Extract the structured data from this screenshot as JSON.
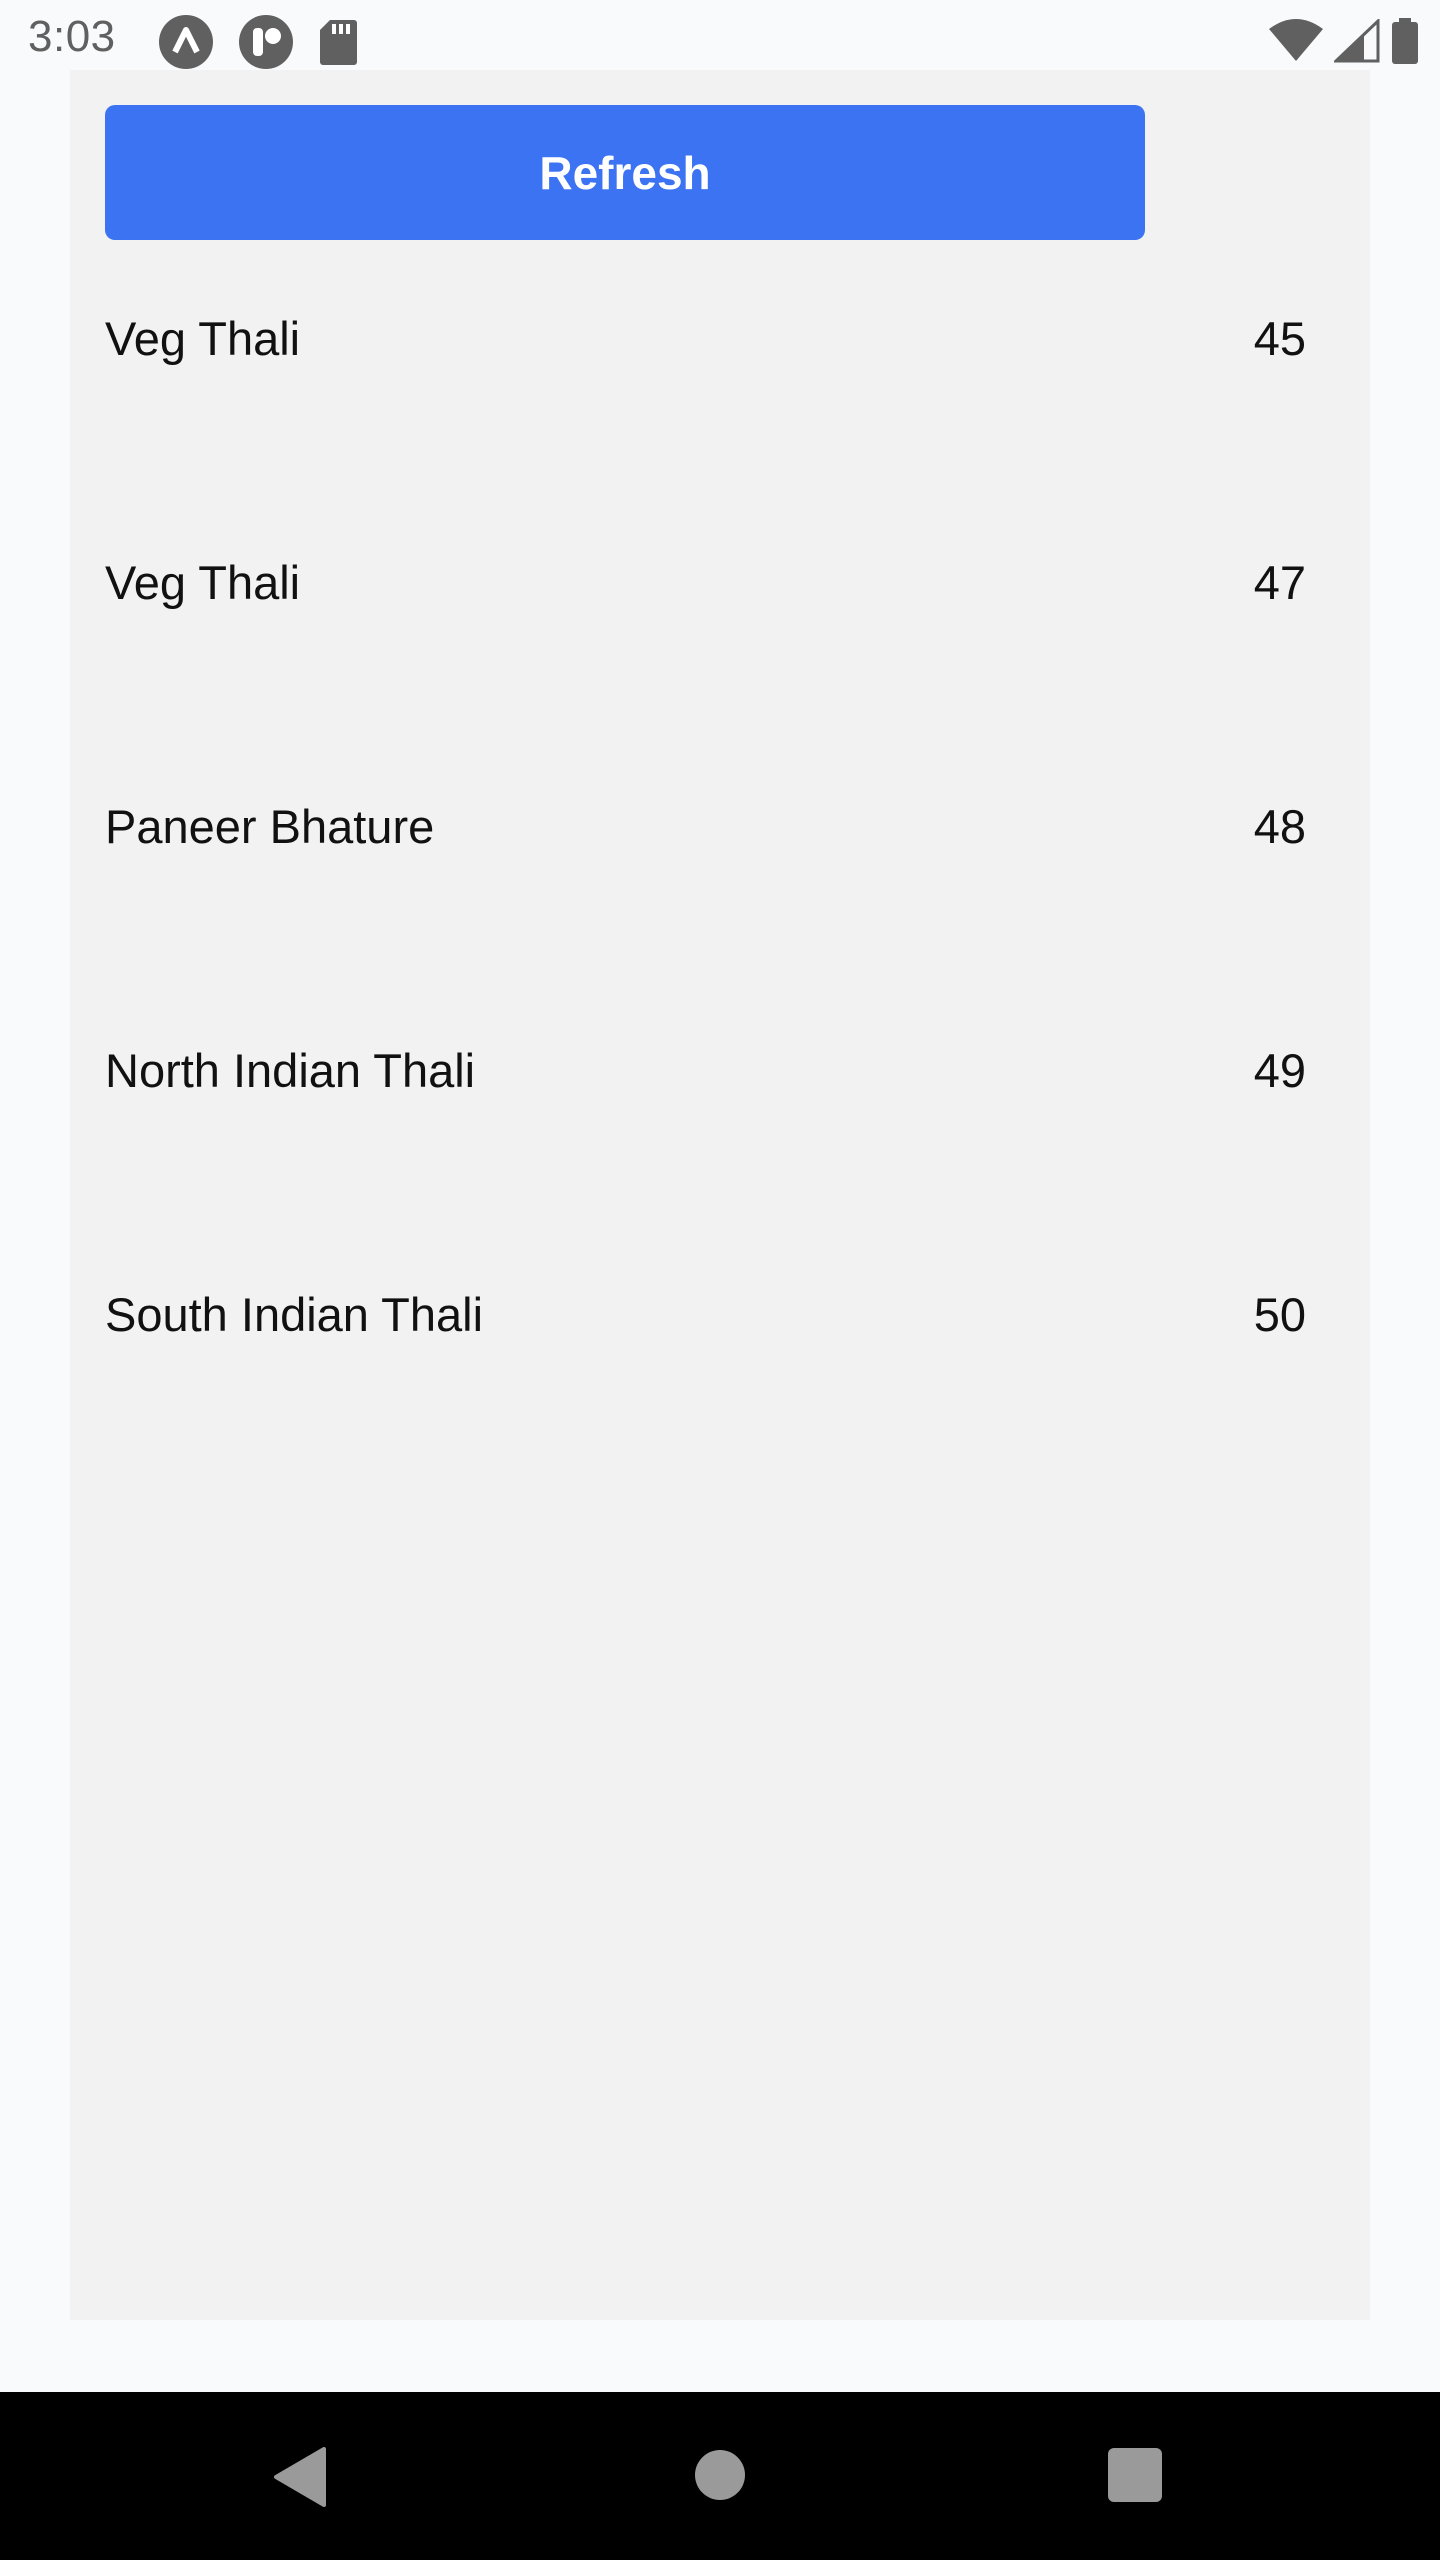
{
  "status_bar": {
    "time": "3:03",
    "left_icons": [
      "expo-icon",
      "mobile-app-icon",
      "sd-card-icon"
    ],
    "right_icons": [
      "wifi-icon",
      "signal-icon",
      "battery-icon"
    ]
  },
  "refresh_button": {
    "label": "Refresh",
    "color": "#3c73f2"
  },
  "items": [
    {
      "name": "Veg Thali",
      "value": "45"
    },
    {
      "name": "Veg Thali",
      "value": "47"
    },
    {
      "name": "Paneer Bhature",
      "value": "48"
    },
    {
      "name": "North Indian Thali",
      "value": "49"
    },
    {
      "name": "South Indian Thali",
      "value": "50"
    }
  ],
  "nav_bar": {
    "buttons": [
      "back-icon",
      "home-icon",
      "recents-icon"
    ]
  }
}
